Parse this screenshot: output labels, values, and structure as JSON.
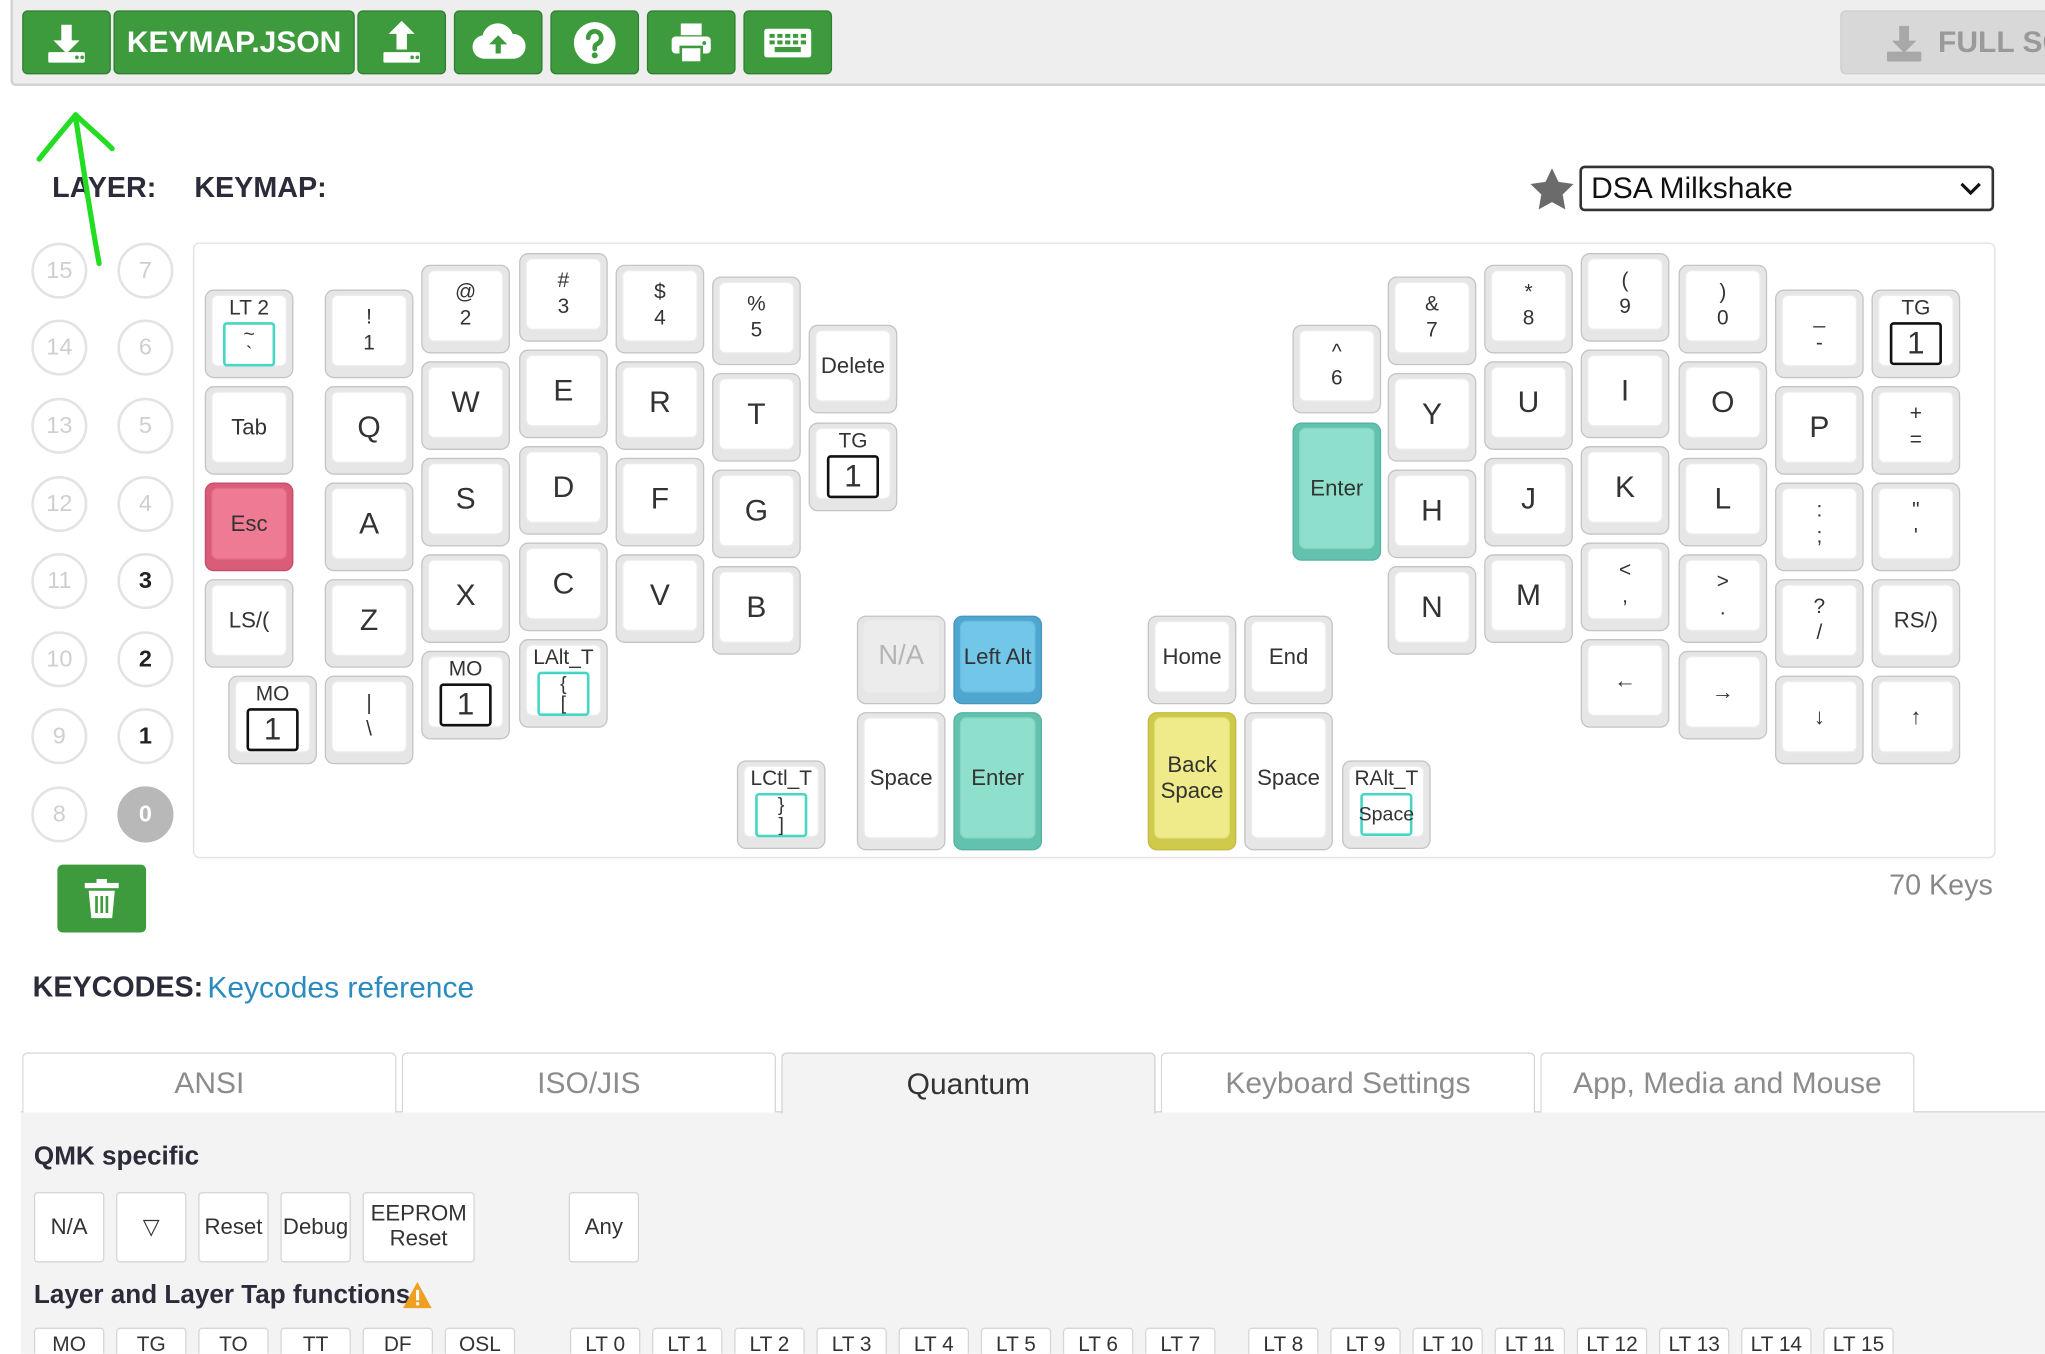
{
  "toolbar": {
    "download_icon": "download-icon",
    "keymap_json_label": "KEYMAP.JSON",
    "upload_icon": "upload-icon",
    "cloud_icon": "cloud-upload-icon",
    "help_icon": "help-icon",
    "print_icon": "print-icon",
    "keyboard_icon": "keyboard-icon",
    "fullscreen_label": "FULL SC",
    "accent_color": "#3d9a3d"
  },
  "layer": {
    "label": "LAYER:",
    "layers_col1": [
      "15",
      "14",
      "13",
      "12",
      "11",
      "10",
      "9",
      "8"
    ],
    "layers_col2": [
      "7",
      "6",
      "5",
      "4",
      "3",
      "2",
      "1",
      "0"
    ],
    "used": [
      "3",
      "2",
      "1"
    ],
    "active": "0"
  },
  "keymap": {
    "label": "KEYMAP:",
    "keyset_select": "DSA Milkshake",
    "keys_count": "70 Keys"
  },
  "keys": {
    "lt2": "LT 2",
    "lt2_inner": "~\n`",
    "k1": "!\n1",
    "k2": "@\n2",
    "k3": "#\n3",
    "k4": "$\n4",
    "k5": "%\n5",
    "delete": "Delete",
    "tab": "Tab",
    "q": "Q",
    "w": "W",
    "e": "E",
    "r": "R",
    "t": "T",
    "tg_left": "TG",
    "tg_left_val": "1",
    "esc": "Esc",
    "a": "A",
    "s": "S",
    "d": "D",
    "f": "F",
    "g": "G",
    "ls": "LS/(",
    "z": "Z",
    "x": "X",
    "c": "C",
    "v": "V",
    "b": "B",
    "mo_a": "MO",
    "mo_a_val": "1",
    "bslash": "|\n\\",
    "mo_b": "MO",
    "mo_b_val": "1",
    "lalt_t": "LAlt_T",
    "lalt_t_inner": "{\n[",
    "na": "N/A",
    "left_alt": "Left Alt",
    "lctl_t": "LCtl_T",
    "lctl_t_inner": "}\n]",
    "space_l": "Space",
    "enter_l": "Enter",
    "home": "Home",
    "end": "End",
    "backspace": "Back\nSpace",
    "space_r": "Space",
    "ralt_t": "RAlt_T",
    "ralt_t_inner": "Space",
    "k6": "^\n6",
    "k7": "&\n7",
    "k8": "*\n8",
    "k9": "(\n9",
    "k0": ")\n0",
    "minus": "_\n-",
    "tg_right": "TG",
    "tg_right_val": "1",
    "enter_r": "Enter",
    "y": "Y",
    "u": "U",
    "i": "I",
    "o": "O",
    "p": "P",
    "plus": "+\n=",
    "h": "H",
    "j": "J",
    "k": "K",
    "l": "L",
    "semi": ":\n;",
    "quote": "\"\n'",
    "n": "N",
    "m": "M",
    "comma": "<\n,",
    "dot": ">\n.",
    "slash": "?\n/",
    "rs": "RS/)",
    "left": "←",
    "right": "→",
    "down": "↓",
    "up": "↑"
  },
  "keycodes": {
    "title": "KEYCODES:",
    "reference_link": "Keycodes reference",
    "tabs": [
      "ANSI",
      "ISO/JIS",
      "Quantum",
      "Keyboard Settings",
      "App, Media and Mouse"
    ],
    "active_tab": "Quantum",
    "qmk_specific": "QMK specific",
    "qmk_keys": [
      "N/A",
      "▽",
      "Reset",
      "Debug",
      "EEPROM\nReset",
      "Any"
    ],
    "layer_funcs_title": "Layer and Layer Tap functions",
    "layer_keys": [
      "MO",
      "TG",
      "TO",
      "TT",
      "DF",
      "OSL"
    ],
    "lt_keys": [
      "LT 0",
      "LT 1",
      "LT 2",
      "LT 3",
      "LT 4",
      "LT 5",
      "LT 6",
      "LT 7",
      "LT 8",
      "LT 9",
      "LT 10",
      "LT 11",
      "LT 12",
      "LT 13",
      "LT 14",
      "LT 15"
    ]
  }
}
